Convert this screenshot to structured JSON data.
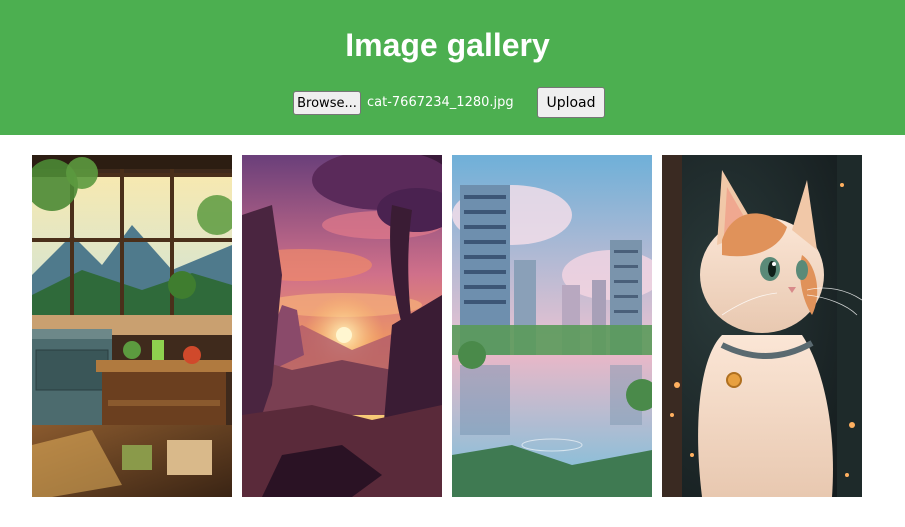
{
  "header": {
    "title": "Image gallery",
    "background_color": "#4caf50"
  },
  "upload_form": {
    "browse_label": "Browse...",
    "selected_file": "cat-7667234_1280.jpg",
    "upload_label": "Upload"
  },
  "gallery": {
    "images": [
      {
        "subject": "illustrated kitchen interior with large windows and plants"
      },
      {
        "subject": "fantasy sunset landscape with rocky cliffs and a tree"
      },
      {
        "subject": "overgrown ruined skyscrapers reflected in water"
      },
      {
        "subject": "illustrated cream and orange cat with a collar"
      }
    ]
  }
}
